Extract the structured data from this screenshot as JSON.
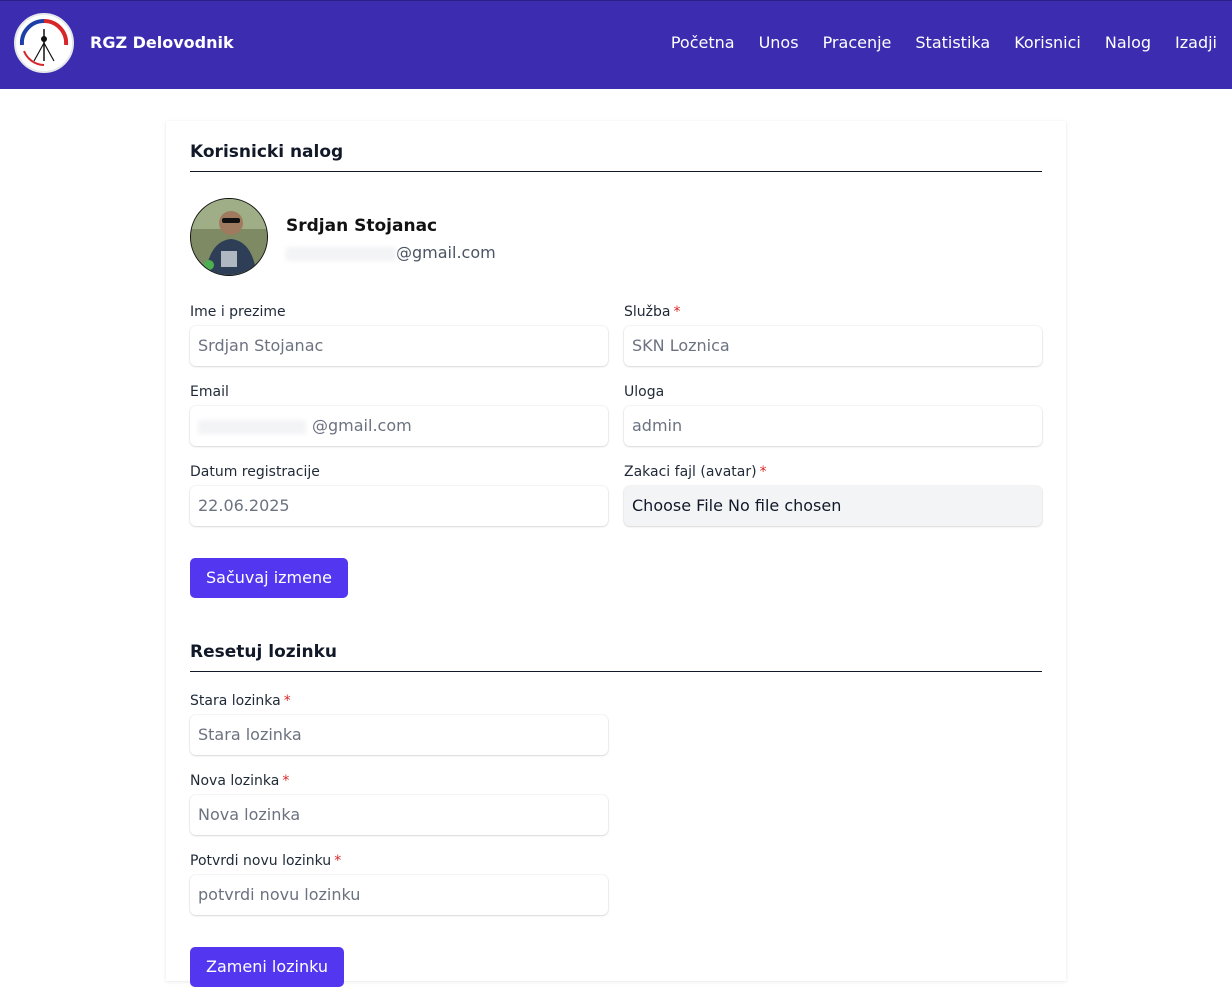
{
  "navbar": {
    "brand": "RGZ Delovodnik",
    "logo_text": "RGZ",
    "links": [
      "Početna",
      "Unos",
      "Pracenje",
      "Statistika",
      "Korisnici",
      "Nalog",
      "Izadji"
    ]
  },
  "profile": {
    "section_title": "Korisnicki nalog",
    "name": "Srdjan Stojanac",
    "email_domain": "@gmail.com"
  },
  "form": {
    "full_name": {
      "label": "Ime i prezime",
      "value": "Srdjan Stojanac"
    },
    "service": {
      "label": "Služba",
      "required_mark": "*",
      "value": "SKN Loznica"
    },
    "email": {
      "label": "Email",
      "value": "@gmail.com"
    },
    "role": {
      "label": "Uloga",
      "value": "admin"
    },
    "registration_date": {
      "label": "Datum registracije",
      "value": "22.06.2025"
    },
    "avatar_upload": {
      "label": "Zakaci fajl (avatar)",
      "required_mark": "*",
      "value": "Choose File No file chosen"
    },
    "save_button": "Sačuvaj izmene"
  },
  "password": {
    "section_title": "Resetuj lozinku",
    "old": {
      "label": "Stara lozinka",
      "required_mark": "*",
      "placeholder": "Stara lozinka"
    },
    "new": {
      "label": "Nova lozinka",
      "required_mark": "*",
      "placeholder": "Nova lozinka"
    },
    "confirm": {
      "label": "Potvrdi novu lozinku",
      "required_mark": "*",
      "placeholder": "potvrdi novu lozinku"
    },
    "submit_button": "Zameni lozinku"
  },
  "colors": {
    "navbar": "#3b2cb0",
    "primary_button": "#5236f0",
    "required": "#dc2626"
  }
}
